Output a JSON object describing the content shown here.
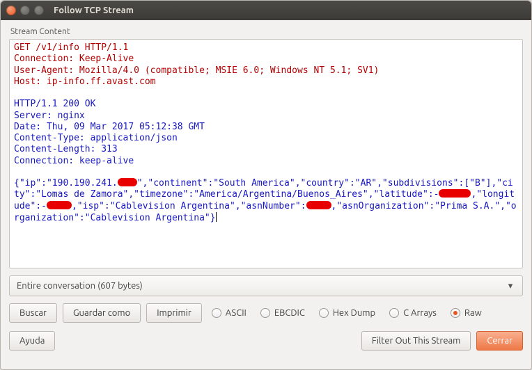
{
  "window": {
    "title": "Follow TCP Stream"
  },
  "section_label": "Stream Content",
  "stream": {
    "request": {
      "l1": "GET /v1/info HTTP/1.1",
      "l2": "Connection: Keep-Alive",
      "l3": "User-Agent: Mozilla/4.0 (compatible; MSIE 6.0; Windows NT 5.1; SV1)",
      "l4": "Host: ip-info.ff.avast.com"
    },
    "response": {
      "l1": "HTTP/1.1 200 OK",
      "l2": "Server: nginx",
      "l3": "Date: Thu, 09 Mar 2017 05:12:38 GMT",
      "l4": "Content-Type: application/json",
      "l5": "Content-Length: 313",
      "l6": "Connection: keep-alive"
    },
    "body": {
      "p1": "{\"ip\":\"190.190.241.",
      "p2": "\",\"continent\":\"South America\",\"country\":\"AR\",\"subdivisions\":[\"B\"],\"city\":\"Lomas de Zamora\",\"timezone\":\"America/Argentina/Buenos_Aires\",\"latitude\":-",
      "p3": ",\"longitude\":-",
      "p4": ",\"isp\":\"Cablevision Argentina\",\"asnNumber\":",
      "p5": ",\"asnOrganization\":\"Prima S.A.\",\"organization\":\"Cablevision Argentina\"}"
    },
    "redaction_widths": {
      "r1": 28,
      "r2": 46,
      "r3": 36,
      "r4": 36
    }
  },
  "dropdown": {
    "selected": "Entire conversation (607 bytes)"
  },
  "buttons": {
    "find": "Buscar",
    "save_as": "Guardar como",
    "print": "Imprimir",
    "help": "Ayuda",
    "filter_out": "Filter Out This Stream",
    "close": "Cerrar"
  },
  "radios": {
    "ascii": "ASCII",
    "ebcdic": "EBCDIC",
    "hexdump": "Hex Dump",
    "carrays": "C Arrays",
    "raw": "Raw",
    "selected": "raw"
  }
}
